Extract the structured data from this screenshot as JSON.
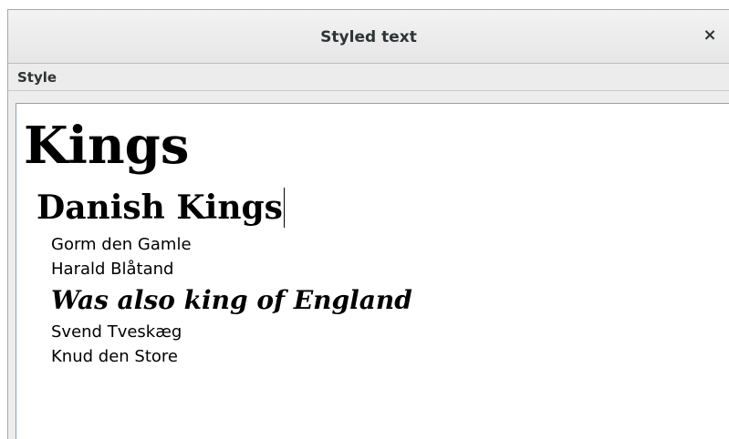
{
  "window": {
    "title": "Styled text",
    "close_label": "×"
  },
  "menubar": {
    "items": [
      {
        "label": "Style"
      }
    ]
  },
  "document": {
    "heading1": "Kings",
    "heading2": "Danish Kings",
    "lines": [
      "Gorm den Gamle",
      "Harald Blåtand",
      "Was also king of England",
      "Svend Tveskæg",
      "Knud den Store"
    ]
  }
}
